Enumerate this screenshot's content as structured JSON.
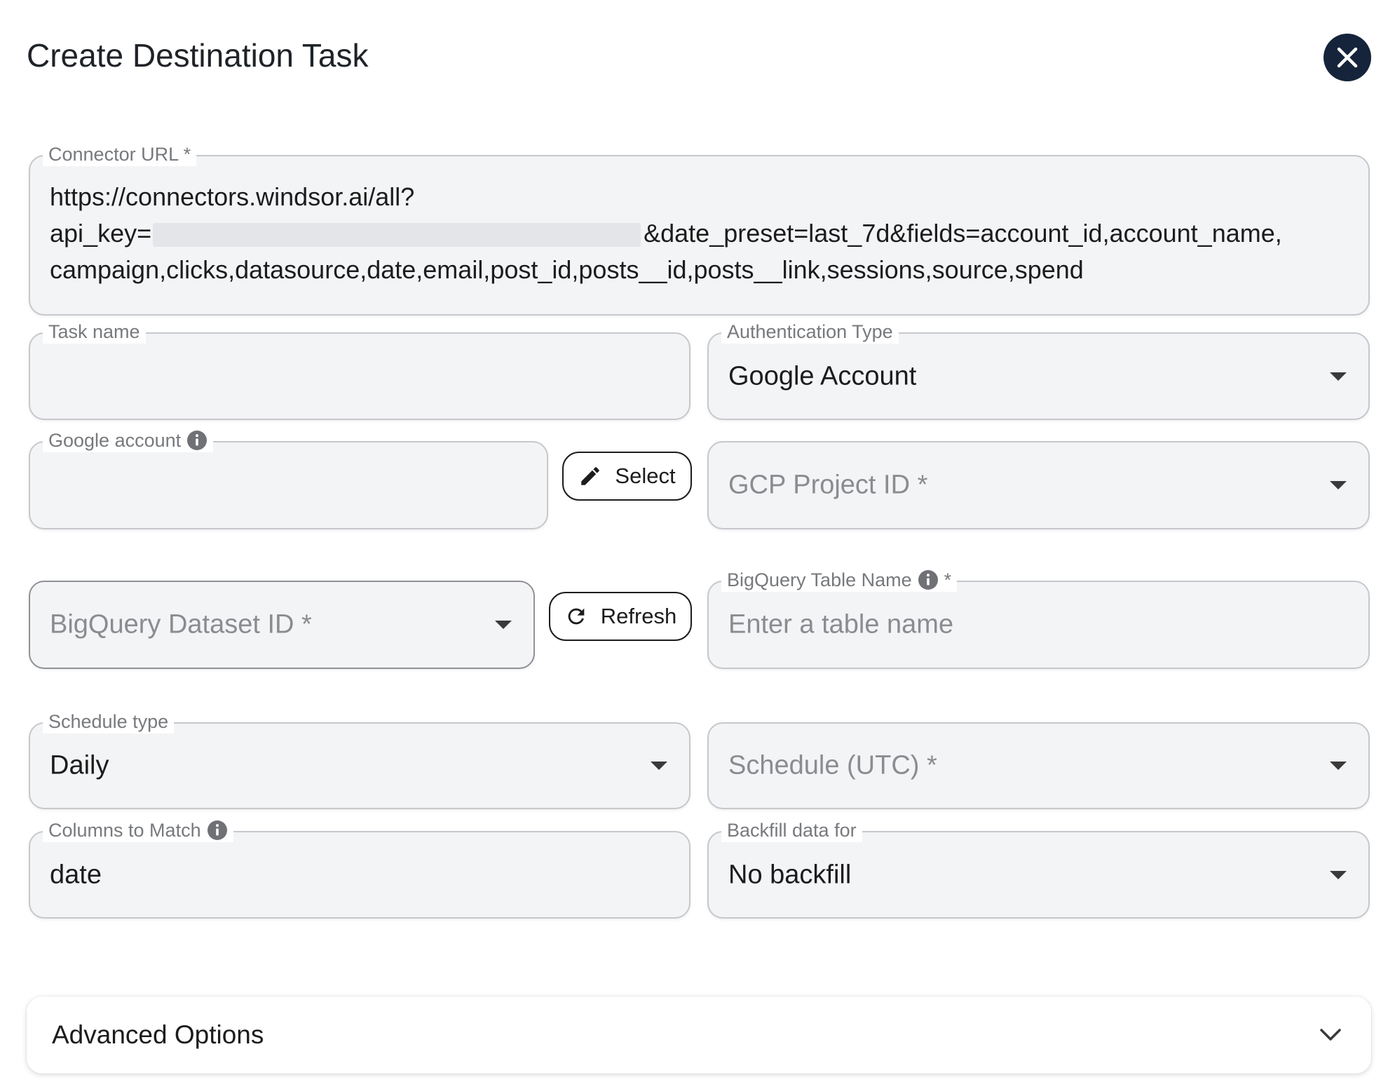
{
  "dialog": {
    "title": "Create Destination Task",
    "close_icon": "close-icon"
  },
  "connector_url": {
    "label": "Connector URL *",
    "line1": "https://connectors.windsor.ai/all?",
    "line2_prefix": "api_key=",
    "line2_suffix": "&date_preset=last_7d&fields=account_id,account_name,",
    "line3": "campaign,clicks,datasource,date,email,post_id,posts__id,posts__link,sessions,source,spend"
  },
  "task_name": {
    "label": "Task name",
    "value": ""
  },
  "auth_type": {
    "label": "Authentication Type",
    "value": "Google Account"
  },
  "google_account": {
    "label": "Google account",
    "value": "",
    "select_label": "Select"
  },
  "gcp_project": {
    "placeholder": "GCP Project ID *"
  },
  "bq_dataset": {
    "placeholder": "BigQuery Dataset ID *",
    "refresh_label": "Refresh"
  },
  "bq_table": {
    "label": "BigQuery Table Name",
    "required_mark": "*",
    "placeholder": "Enter a table name"
  },
  "schedule_type": {
    "label": "Schedule type",
    "value": "Daily"
  },
  "schedule_utc": {
    "placeholder": "Schedule (UTC) *"
  },
  "columns_to_match": {
    "label": "Columns to Match",
    "value": "date"
  },
  "backfill": {
    "label": "Backfill data for",
    "value": "No backfill"
  },
  "advanced": {
    "label": "Advanced Options"
  },
  "colors": {
    "close_bg": "#15243a",
    "field_bg": "#f3f4f6",
    "border": "#c6c8cc",
    "label": "#77797d"
  }
}
